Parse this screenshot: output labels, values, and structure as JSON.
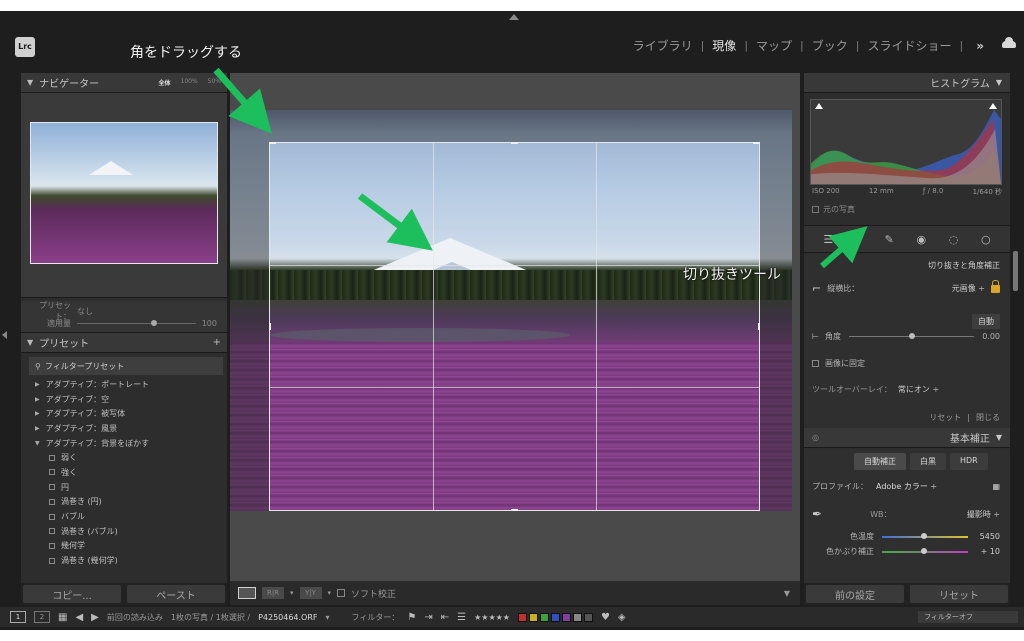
{
  "header": {
    "logo": "Lrc",
    "modules": [
      "ライブラリ",
      "現像",
      "マップ",
      "ブック",
      "スライドショー"
    ],
    "active_module": "現像",
    "more": "»"
  },
  "annotations": {
    "drag_corner": "角をドラッグする",
    "crop_tool": "切り抜きツール"
  },
  "left": {
    "navigator": {
      "title": "ナビゲーター",
      "zooms": [
        "全体",
        "100%",
        "50%"
      ]
    },
    "preset_amount": {
      "preset_label": "プリセット：",
      "preset_value": "なし",
      "amount_label": "適用量",
      "amount_value": "100"
    },
    "presets": {
      "title": "プリセット",
      "add": "+",
      "filter": "フィルタープリセット",
      "items": [
        {
          "label": "アダプティブ：ポートレート",
          "sub": false
        },
        {
          "label": "アダプティブ：空",
          "sub": false
        },
        {
          "label": "アダプティブ：被写体",
          "sub": false
        },
        {
          "label": "アダプティブ：風景",
          "sub": false
        },
        {
          "label": "アダプティブ：背景をぼかす",
          "sub": false,
          "open": true
        },
        {
          "label": "弱く",
          "sub": true
        },
        {
          "label": "強く",
          "sub": true
        },
        {
          "label": "円",
          "sub": true
        },
        {
          "label": "渦巻き (円)",
          "sub": true
        },
        {
          "label": "バブル",
          "sub": true
        },
        {
          "label": "渦巻き (バブル)",
          "sub": true
        },
        {
          "label": "幾何学",
          "sub": true
        },
        {
          "label": "渦巻き (幾何学)",
          "sub": true
        }
      ]
    },
    "copy_label": "コピー...",
    "paste_label": "ペースト"
  },
  "center": {
    "soft_proof": "ソフト校正",
    "view_compare": "R|R",
    "view_before_after": "Y|Y"
  },
  "right": {
    "histogram": {
      "title": "ヒストグラム",
      "iso": "ISO 200",
      "focal": "12 mm",
      "aperture": "ƒ / 8.0",
      "shutter": "1/640 秒",
      "original_photo": "元の写真"
    },
    "crop": {
      "title": "切り抜きと角度補正",
      "aspect_label": "縦横比：",
      "aspect_value": "元画像 ÷",
      "auto": "自動",
      "angle_label": "角度",
      "angle_value": "0.00",
      "constrain": "画像に固定",
      "overlay_label": "ツールオーバーレイ：",
      "overlay_value": "常にオン ÷",
      "reset": "リセット",
      "close": "閉じる"
    },
    "basic": {
      "title": "基本補正",
      "auto_tone": "自動補正",
      "bw": "白黒",
      "hdr": "HDR",
      "profile_label": "プロファイル：",
      "profile_value": "Adobe カラー ÷",
      "wb_label": "WB：",
      "wb_value": "撮影時 ÷",
      "temp_label": "色温度",
      "temp_value": "5450",
      "tint_label": "色かぶり補正",
      "tint_value": "+ 10"
    },
    "prev_label": "前の設定",
    "reset_label": "リセット"
  },
  "filmstrip": {
    "page1": "1",
    "page2": "2",
    "source": "前回の読み込み",
    "count": "1枚の写真 / 1枚選択 /",
    "filename": "P4250464.ORF",
    "filter_label": "フィルター：",
    "filter_value": "フィルターオフ",
    "stars": "★★★★★",
    "swatch_colors": [
      "#c03030",
      "#c8b020",
      "#40a040",
      "#3050c0",
      "#8040a0",
      "#888888",
      "#555555"
    ]
  }
}
